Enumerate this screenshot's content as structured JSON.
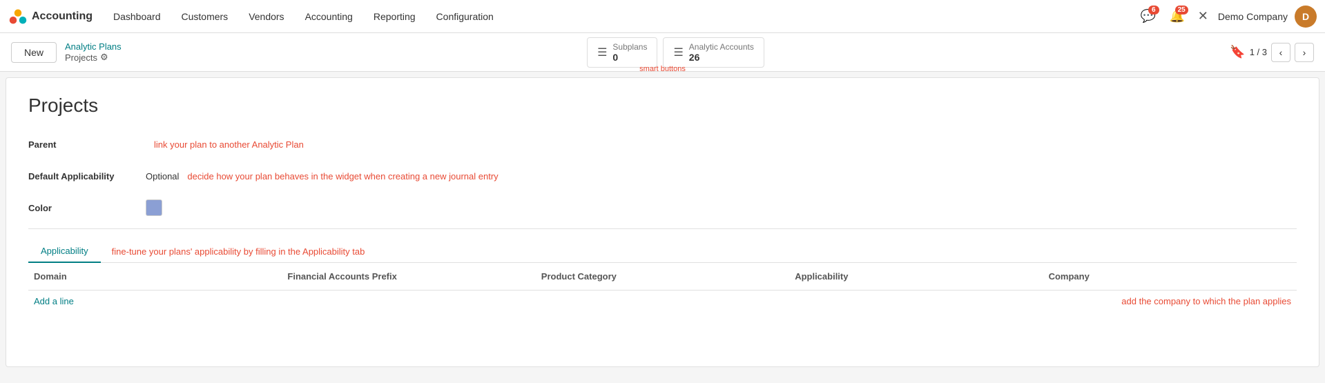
{
  "topnav": {
    "app_name": "Accounting",
    "menu_items": [
      "Dashboard",
      "Customers",
      "Vendors",
      "Accounting",
      "Reporting",
      "Configuration"
    ],
    "notifications_count": "6",
    "alerts_count": "25",
    "company": "Demo Company"
  },
  "subheader": {
    "new_button": "New",
    "breadcrumb_parent": "Analytic Plans",
    "breadcrumb_current": "Projects",
    "smart_buttons": [
      {
        "label": "Subplans",
        "count": "0"
      },
      {
        "label": "Analytic Accounts",
        "count": "26"
      }
    ],
    "smart_buttons_caption": "smart buttons",
    "pagination": {
      "current": "1",
      "total": "3"
    }
  },
  "form": {
    "title": "Projects",
    "fields": {
      "parent_label": "Parent",
      "parent_hint": "link your plan to another Analytic Plan",
      "default_applicability_label": "Default Applicability",
      "default_applicability_value": "Optional",
      "default_applicability_hint": "decide how your plan behaves in the widget when creating a new journal entry",
      "color_label": "Color"
    },
    "tab_label": "Applicability",
    "tab_hint": "fine-tune your plans' applicability by filling in the Applicability tab",
    "table_headers": [
      "Domain",
      "Financial Accounts Prefix",
      "Product Category",
      "Applicability",
      "Company"
    ],
    "add_line_label": "Add a line",
    "company_hint": "add the company to which the plan applies"
  }
}
